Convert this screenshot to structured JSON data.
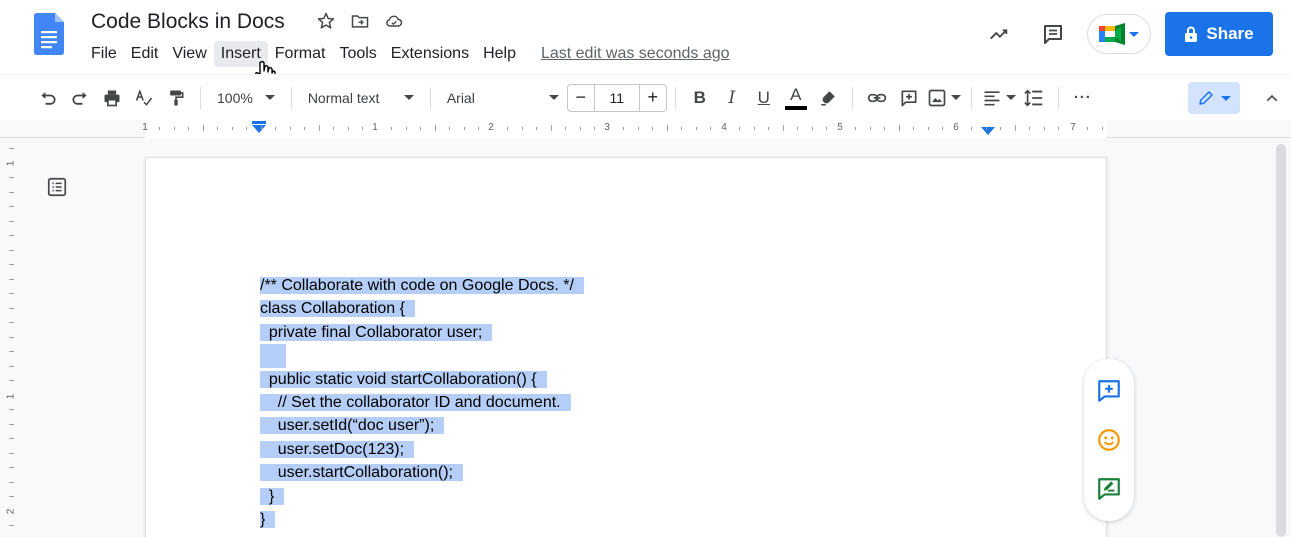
{
  "document": {
    "title": "Code Blocks in Docs",
    "last_edit": "Last edit was seconds ago"
  },
  "menu": [
    "File",
    "Edit",
    "View",
    "Insert",
    "Format",
    "Tools",
    "Extensions",
    "Help"
  ],
  "menu_hovered": "Insert",
  "share_label": "Share",
  "toolbar": {
    "zoom": "100%",
    "style": "Normal text",
    "font": "Arial",
    "font_size": "11",
    "minus": "−",
    "plus": "+",
    "bold": "B",
    "italic": "I",
    "underline": "U",
    "text_color": "A",
    "more": "···"
  },
  "ruler": {
    "horizontal_numbers": [
      "1",
      "1",
      "2",
      "3",
      "4",
      "5",
      "6",
      "7"
    ],
    "vertical_numbers": [
      "1",
      "1",
      "2"
    ]
  },
  "code_lines": [
    "/** Collaborate with code on Google Docs. */",
    "class Collaboration {",
    "  private final Collaborator user;",
    "",
    "  public static void startCollaboration() {",
    "    // Set the collaborator ID and document.",
    "    user.setId(“doc user”);",
    "    user.setDoc(123);",
    "    user.startCollaboration();",
    "  }",
    "}"
  ],
  "colors": {
    "accent": "#1a73e8",
    "selection": "#b4cef7",
    "emoji_orange": "#f29900",
    "suggest_green": "#188038"
  },
  "icons": {
    "star": "star-icon",
    "move": "move-to-folder-icon",
    "cloud": "cloud-status-icon",
    "activity": "activity-trend-icon",
    "comments": "comments-icon",
    "meet": "google-meet-icon",
    "lock": "lock-icon",
    "undo": "undo-icon",
    "redo": "redo-icon",
    "print": "print-icon",
    "spellcheck": "spellcheck-icon",
    "paint_format": "paint-format-icon",
    "highlight": "highlighter-icon",
    "link": "link-icon",
    "add_comment": "add-comment-icon",
    "image": "insert-image-icon",
    "align": "align-left-icon",
    "line_spacing": "line-spacing-icon",
    "edit_mode": "pencil-icon",
    "collapse": "chevron-up-icon",
    "outline": "document-outline-icon",
    "emoji": "emoji-reaction-icon",
    "suggest": "suggest-edits-icon",
    "pointer": "hand-pointer-cursor-icon"
  }
}
